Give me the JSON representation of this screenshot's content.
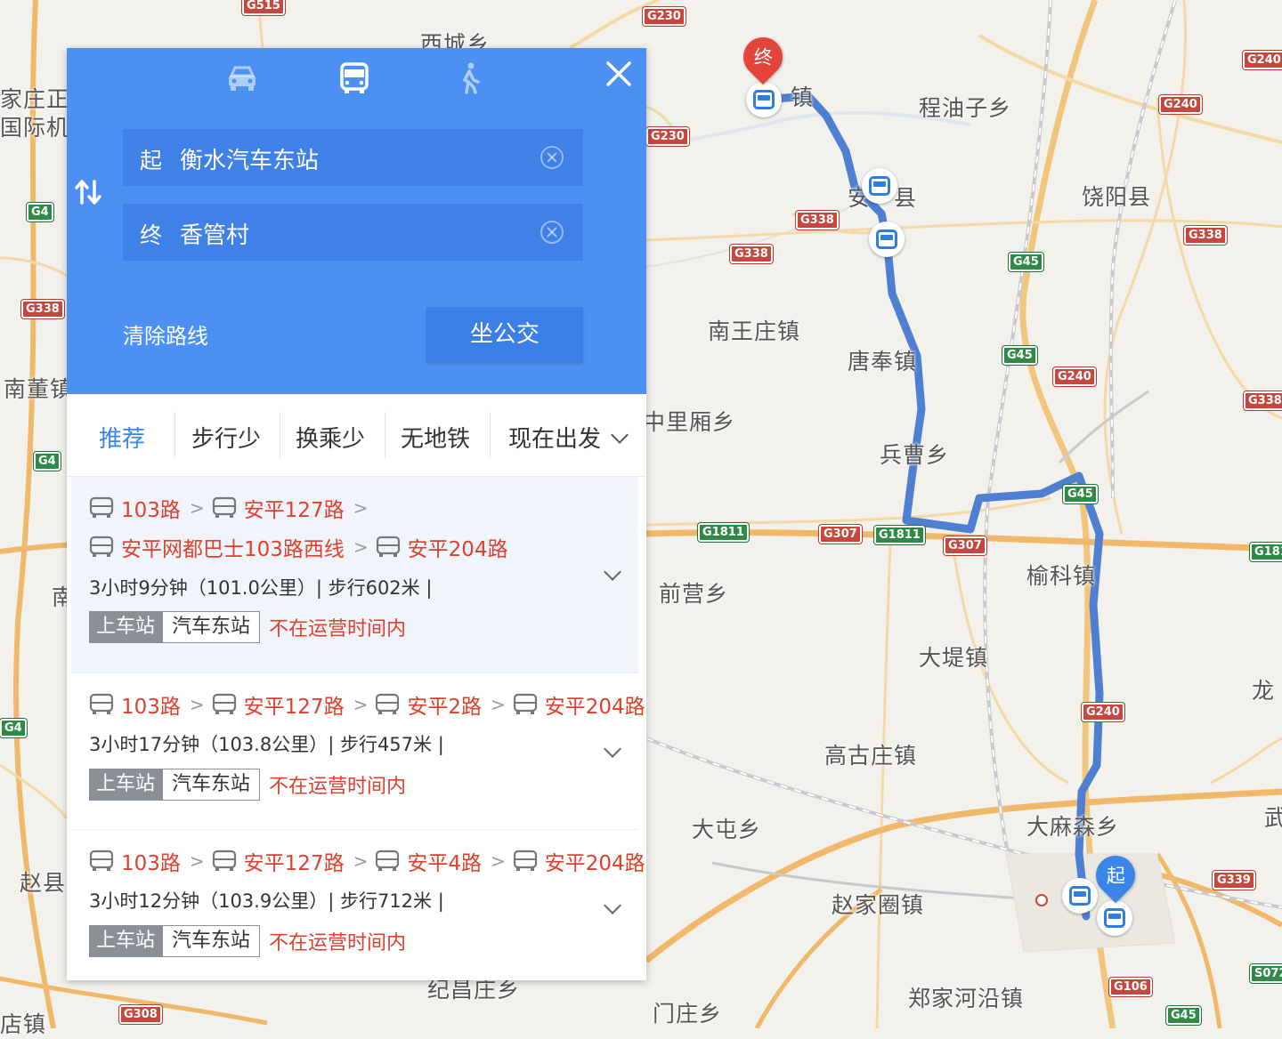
{
  "map": {
    "places": [
      {
        "id": "xicheng",
        "text": "西城乡"
      },
      {
        "id": "shenzhen-zhen",
        "text": "镇"
      },
      {
        "id": "chengyouzi",
        "text": "程油子乡"
      },
      {
        "id": "anping",
        "text": "县"
      },
      {
        "id": "anping-a",
        "text": "安"
      },
      {
        "id": "raoyang",
        "text": "饶阳县"
      },
      {
        "id": "nanwangzhuang",
        "text": "南王庄镇"
      },
      {
        "id": "tangfeng",
        "text": "唐奉镇"
      },
      {
        "id": "zhonglixiang",
        "text": "中里厢乡"
      },
      {
        "id": "bingcao",
        "text": "兵曹乡"
      },
      {
        "id": "yuke",
        "text": "榆科镇"
      },
      {
        "id": "qianying",
        "text": "前营乡"
      },
      {
        "id": "dadi",
        "text": "大堤镇"
      },
      {
        "id": "long",
        "text": "龙"
      },
      {
        "id": "gaoguzhuang",
        "text": "高古庄镇"
      },
      {
        "id": "datun",
        "text": "大屯乡"
      },
      {
        "id": "damasen",
        "text": "大麻森乡"
      },
      {
        "id": "wu",
        "text": "武"
      },
      {
        "id": "zhaojiaquan",
        "text": "赵家圈镇"
      },
      {
        "id": "jichangzhuang",
        "text": "纪昌庄乡"
      },
      {
        "id": "menzhuang",
        "text": "门庄乡"
      },
      {
        "id": "zhengjiahe",
        "text": "郑家河沿镇"
      },
      {
        "id": "zhaoxian",
        "text": "赵县"
      },
      {
        "id": "nandong",
        "text": "南董镇"
      },
      {
        "id": "nan",
        "text": "南"
      },
      {
        "id": "jiazhuang1",
        "text": "家庄正"
      },
      {
        "id": "guojiji",
        "text": "国际机"
      },
      {
        "id": "dianzhen",
        "text": "店镇"
      }
    ],
    "shields": [
      {
        "id": "s1",
        "text": "G515",
        "kind": "red"
      },
      {
        "id": "s2",
        "text": "G230",
        "kind": "red"
      },
      {
        "id": "s3",
        "text": "G230",
        "kind": "red"
      },
      {
        "id": "s4",
        "text": "G240",
        "kind": "red"
      },
      {
        "id": "s5",
        "text": "G240",
        "kind": "red"
      },
      {
        "id": "s6",
        "text": "G338",
        "kind": "red"
      },
      {
        "id": "s7",
        "text": "G338",
        "kind": "red"
      },
      {
        "id": "s8",
        "text": "G338",
        "kind": "red"
      },
      {
        "id": "s9",
        "text": "G45",
        "kind": "green"
      },
      {
        "id": "s10",
        "text": "G45",
        "kind": "green"
      },
      {
        "id": "s11",
        "text": "G240",
        "kind": "red"
      },
      {
        "id": "s12",
        "text": "G338",
        "kind": "red"
      },
      {
        "id": "s13",
        "text": "G45",
        "kind": "green"
      },
      {
        "id": "s14",
        "text": "G1811",
        "kind": "green"
      },
      {
        "id": "s15",
        "text": "G307",
        "kind": "red"
      },
      {
        "id": "s16",
        "text": "G1811",
        "kind": "green"
      },
      {
        "id": "s17",
        "text": "G307",
        "kind": "red"
      },
      {
        "id": "s18",
        "text": "G181",
        "kind": "green"
      },
      {
        "id": "s19",
        "text": "G240",
        "kind": "red"
      },
      {
        "id": "s20",
        "text": "G339",
        "kind": "red"
      },
      {
        "id": "s21",
        "text": "S072",
        "kind": "green"
      },
      {
        "id": "s22",
        "text": "G106",
        "kind": "red"
      },
      {
        "id": "s23",
        "text": "G45",
        "kind": "green"
      },
      {
        "id": "s24",
        "text": "G308",
        "kind": "red"
      },
      {
        "id": "s25",
        "text": "G4",
        "kind": "green"
      },
      {
        "id": "s26",
        "text": "G338",
        "kind": "red"
      },
      {
        "id": "s27",
        "text": "G4",
        "kind": "green"
      },
      {
        "id": "s28",
        "text": "G4",
        "kind": "green"
      }
    ],
    "start_pin": "起",
    "end_pin": "终"
  },
  "panel": {
    "modes": [
      {
        "id": "drive",
        "icon": "car-icon",
        "active": false
      },
      {
        "id": "bus",
        "icon": "bus-icon",
        "active": true
      },
      {
        "id": "walk",
        "icon": "walk-icon",
        "active": false
      }
    ],
    "start_tag": "起",
    "start_value": "衡水汽车东站",
    "end_tag": "终",
    "end_value": "香管村",
    "clear_route": "清除路线",
    "go_button": "坐公交",
    "filters": [
      "推荐",
      "步行少",
      "换乘少",
      "无地铁"
    ],
    "depart": "现在出发",
    "routes": [
      {
        "lines_row1": [
          "103路",
          "安平127路"
        ],
        "lines_row2": [
          "安平网都巴士103路西线",
          "安平204路"
        ],
        "meta": "3小时9分钟（101.0公里）| 步行602米 |",
        "board_label": "上车站",
        "board_station": "汽车东站",
        "status": "不在运营时间内"
      },
      {
        "lines_row1": [
          "103路",
          "安平127路",
          "安平2路",
          "安平204路"
        ],
        "meta": "3小时17分钟（103.8公里）| 步行457米 |",
        "board_label": "上车站",
        "board_station": "汽车东站",
        "status": "不在运营时间内"
      },
      {
        "lines_row1": [
          "103路",
          "安平127路",
          "安平4路",
          "安平204路"
        ],
        "meta": "3小时12分钟（103.9公里）| 步行712米 |",
        "board_label": "上车站",
        "board_station": "汽车东站",
        "status": "不在运营时间内"
      }
    ]
  },
  "colors": {
    "panel_header": "#4d90f3",
    "route_line": "#4f7fd0",
    "route_name": "#e0402b",
    "active_filter": "#3a85e6"
  }
}
